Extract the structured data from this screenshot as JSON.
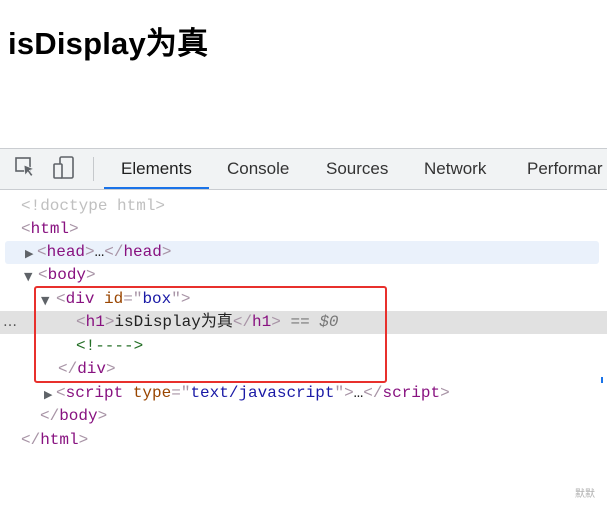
{
  "page": {
    "heading": "isDisplay为真"
  },
  "toolbar": {
    "inspect_icon": "inspect-element-icon",
    "device_icon": "device-toolbar-icon",
    "tabs": [
      {
        "label": "Elements",
        "active": true
      },
      {
        "label": "Console"
      },
      {
        "label": "Sources"
      },
      {
        "label": "Network"
      },
      {
        "label": "Performar"
      }
    ]
  },
  "tree": {
    "doctype": "<!doctype html>",
    "html_open": "html",
    "head_tag": "head",
    "head_ellipsis": "…",
    "body_tag": "body",
    "div_tag": "div",
    "div_attr_name": "id",
    "div_attr_value": "box",
    "h1_tag": "h1",
    "h1_text": "isDisplay为真",
    "selected_marker": "== $0",
    "comment": "<!---->",
    "script_tag": "script",
    "script_attr_name": "type",
    "script_attr_value": "text/javascript",
    "script_ellipsis": "…",
    "row_menu": "…"
  },
  "watermark": "默默",
  "colors": {
    "accent": "#1a73e8",
    "highlight_border": "#e8302c",
    "tag": "#881280",
    "attr": "#994500",
    "value": "#1a1aa6",
    "comment": "#236e25"
  }
}
